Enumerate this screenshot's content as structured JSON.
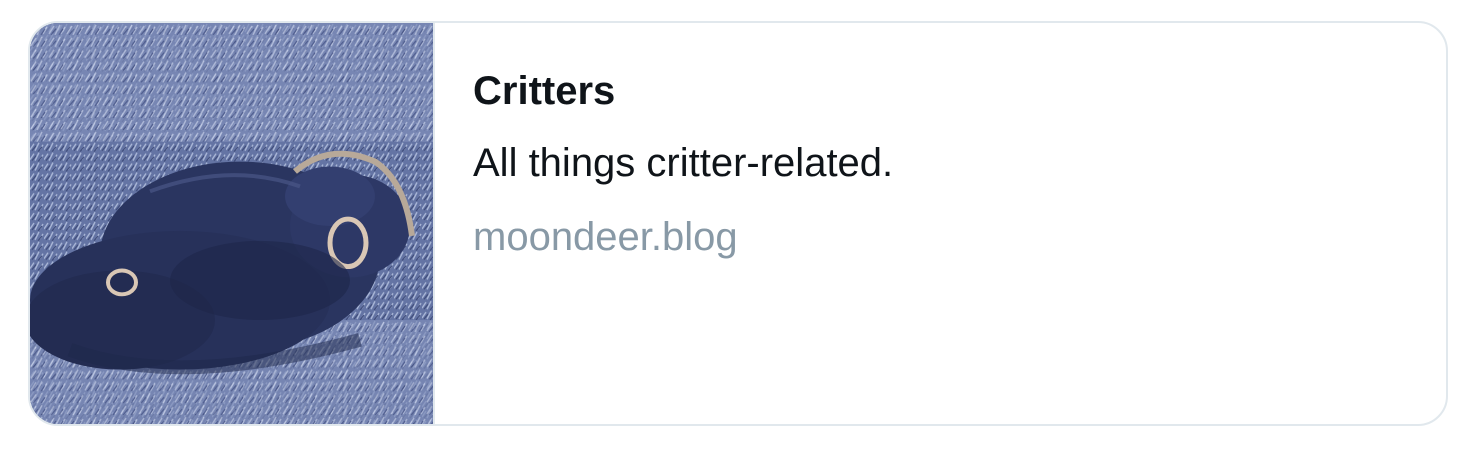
{
  "card": {
    "title": "Critters",
    "description": "All things critter-related.",
    "domain": "moondeer.blog",
    "thumbnail": {
      "subject": "animal-photo",
      "palette": {
        "ground_light": "#a9b6d6",
        "ground_mid": "#6f7fae",
        "ground_dark": "#3f4c7a",
        "animal": "#2a3560",
        "animal_shadow": "#1e274a",
        "highlight": "#d9c7b5"
      }
    },
    "colors": {
      "border": "#e1e8ed",
      "title": "#0f1419",
      "description": "#0f1419",
      "domain": "#8899a6"
    }
  }
}
